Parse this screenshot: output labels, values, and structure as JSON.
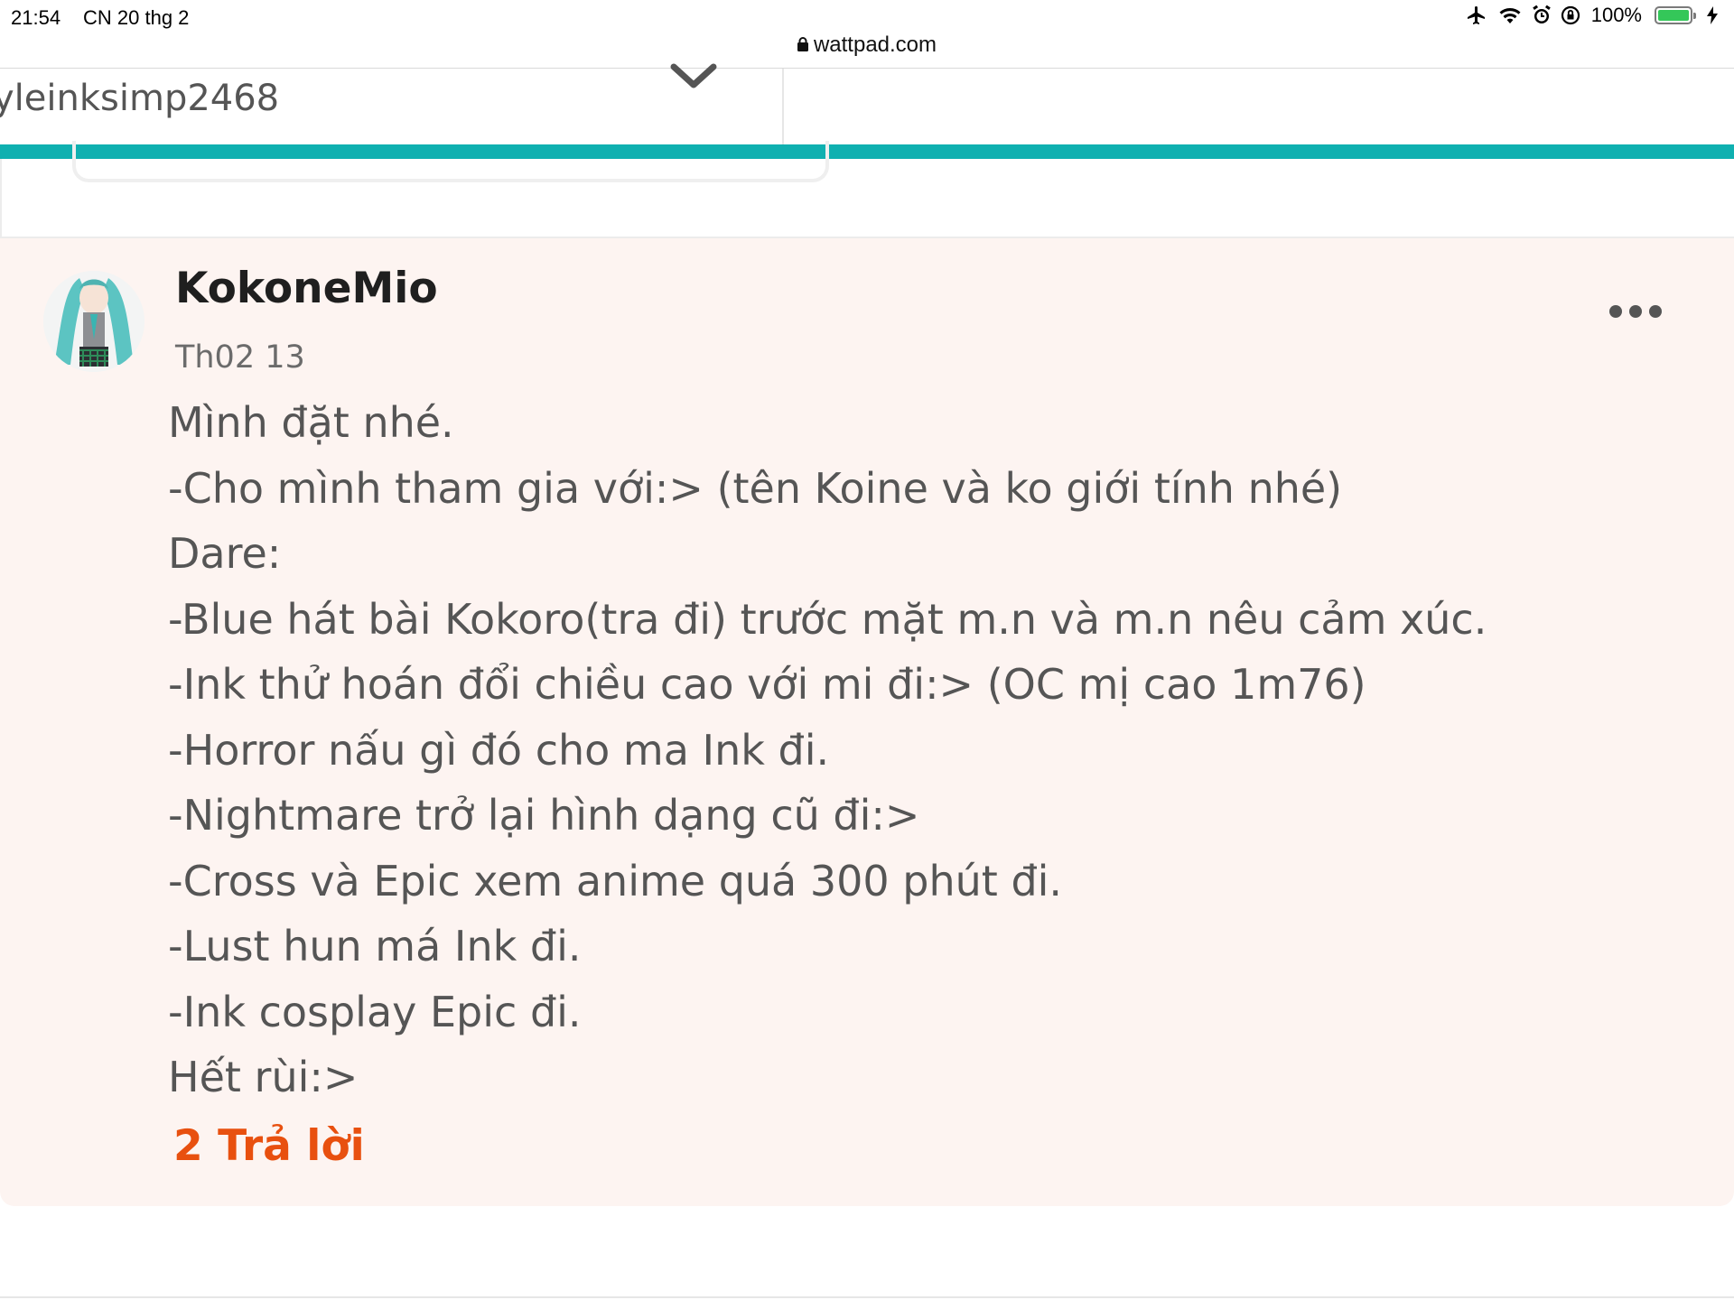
{
  "status_bar": {
    "time": "21:54",
    "date": "CN 20 thg 2",
    "battery_percent": "100%",
    "battery_level": 1.0,
    "icons": [
      "airplane-icon",
      "wifi-icon",
      "alarm-icon",
      "rotation-lock-icon",
      "battery-icon",
      "charging-icon"
    ]
  },
  "url_bar": {
    "domain": "wattpad.com"
  },
  "header": {
    "username": "yleinksimp2468"
  },
  "colors": {
    "accent_teal": "#0fb0b0",
    "reply_orange": "#e8500f",
    "comment_bg": "#fdf4f1"
  },
  "comment": {
    "author": "KokoneMio",
    "date": "Th02 13",
    "lines": [
      "Mình đặt nhé.",
      "-Cho mình tham gia với:> (tên Koine và ko giới tính nhé)",
      "Dare:",
      "-Blue hát bài Kokoro(tra đi) trước mặt m.n và m.n nêu cảm xúc.",
      "-Ink thử hoán đổi chiều cao với mi đi:> (OC mị cao 1m76)",
      "-Horror nấu gì đó cho ma Ink đi.",
      "-Nightmare trở lại hình dạng cũ đi:>",
      "-Cross và Epic xem anime quá 300 phút đi.",
      "-Lust hun má Ink đi.",
      "-Ink cosplay Epic đi.",
      "Hết rùi:>"
    ],
    "replies_label": "2 Trả lời"
  }
}
